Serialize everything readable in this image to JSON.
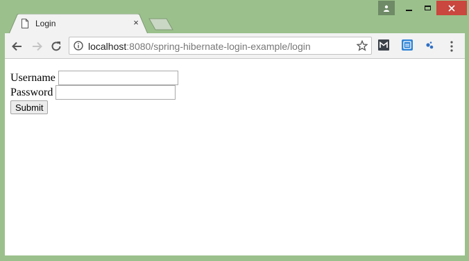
{
  "browser": {
    "tab": {
      "title": "Login",
      "close_glyph": "×"
    },
    "address_bar": {
      "host": "localhost",
      "path": ":8080/spring-hibernate-login-example/login"
    },
    "colors": {
      "frame": "#9bc08c",
      "close_button": "#c9473e",
      "toolbar": "#f2f2f2"
    },
    "icons": [
      "user-profile-icon",
      "minimize-icon",
      "maximize-icon",
      "close-icon",
      "document-icon",
      "back-arrow-icon",
      "forward-arrow-icon",
      "reload-icon",
      "info-icon",
      "star-icon",
      "gmail-extension-icon",
      "pocket-extension-icon",
      "extension-dots-icon",
      "kebab-menu-icon"
    ]
  },
  "form": {
    "username_label": "Username",
    "username_value": "",
    "password_label": "Password",
    "password_value": "",
    "submit_label": "Submit"
  }
}
